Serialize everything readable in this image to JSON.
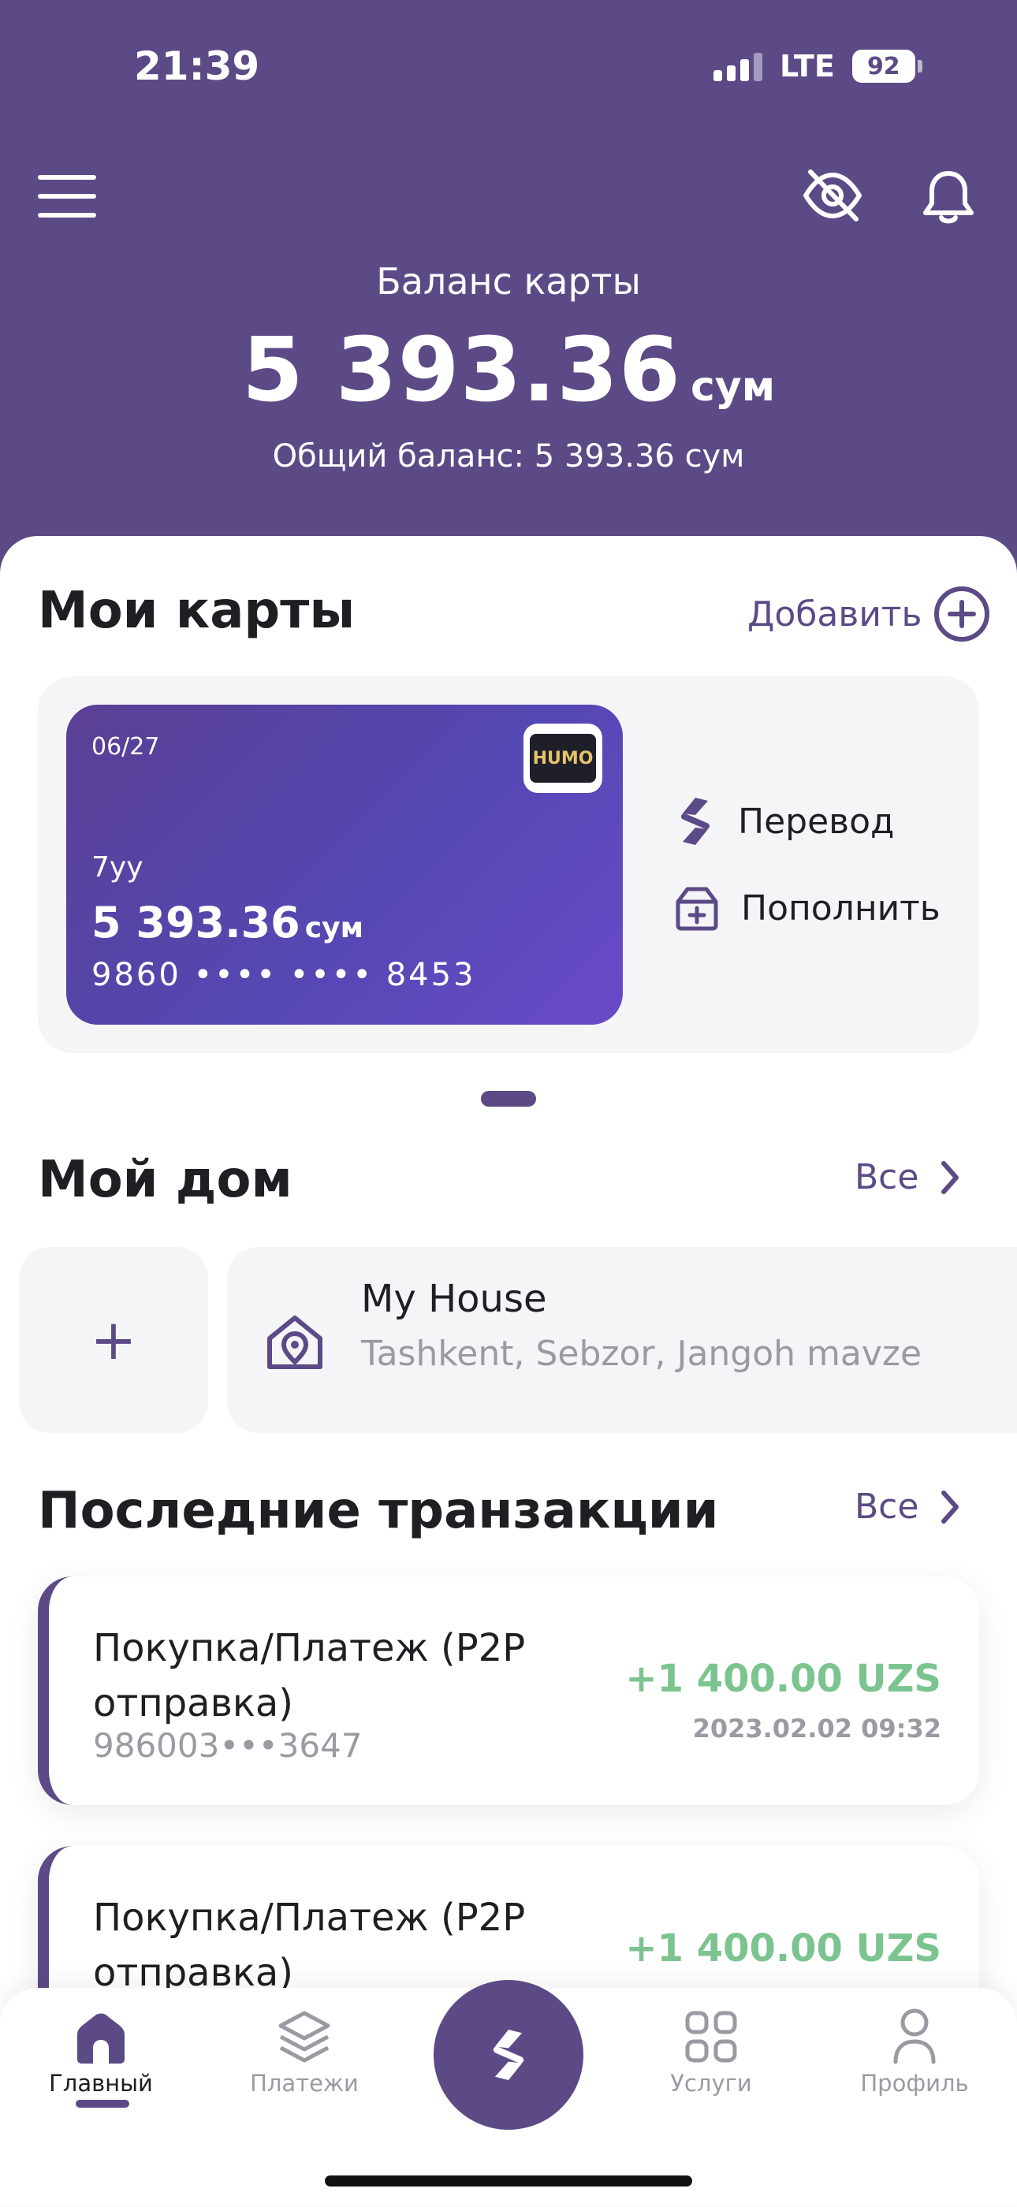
{
  "status_bar": {
    "time": "21:39",
    "network": "LTE",
    "battery": "92"
  },
  "header": {
    "balance_label": "Баланс карты",
    "balance_amount": "5 393.36",
    "balance_currency": "сум",
    "total_balance": "Общий баланс: 5 393.36 сум"
  },
  "cards_section": {
    "title": "Мои карты",
    "add_label": "Добавить",
    "card": {
      "expiry": "06/27",
      "brand": "HUMO",
      "name": "7yy",
      "balance": "5 393.36",
      "currency": "сум",
      "number": "9860 •••• •••• 8453"
    },
    "actions": [
      {
        "label": "Перевод",
        "icon": "transfer-icon"
      },
      {
        "label": "Пополнить",
        "icon": "top-up-icon"
      }
    ]
  },
  "home_section": {
    "title": "Мой дом",
    "all_label": "Все",
    "add_symbol": "+",
    "house": {
      "title": "My House",
      "address": "Tashkent, Sebzor, Jangoh mavze"
    }
  },
  "transactions_section": {
    "title": "Последние транзакции",
    "all_label": "Все",
    "items": [
      {
        "title": "Покупка/Платеж (P2P отправка)",
        "card": "986003•••3647",
        "amount": "+1 400.00 UZS",
        "date": "2023.02.02 09:32"
      },
      {
        "title": "Покупка/Платеж (P2P отправка)",
        "card": "",
        "amount": "+1 400.00 UZS",
        "date": ""
      }
    ]
  },
  "bottom_nav": {
    "items": [
      {
        "label": "Главный",
        "icon": "home-icon",
        "active": true
      },
      {
        "label": "Платежи",
        "icon": "layers-icon",
        "active": false
      },
      {
        "label": "Услуги",
        "icon": "grid-icon",
        "active": false
      },
      {
        "label": "Профиль",
        "icon": "person-icon",
        "active": false
      }
    ],
    "center_icon": "transfer-icon"
  },
  "colors": {
    "primary": "#5c4a86",
    "positive": "#7cc48f",
    "muted": "#9a9aa2",
    "surface": "#f5f5f8"
  }
}
